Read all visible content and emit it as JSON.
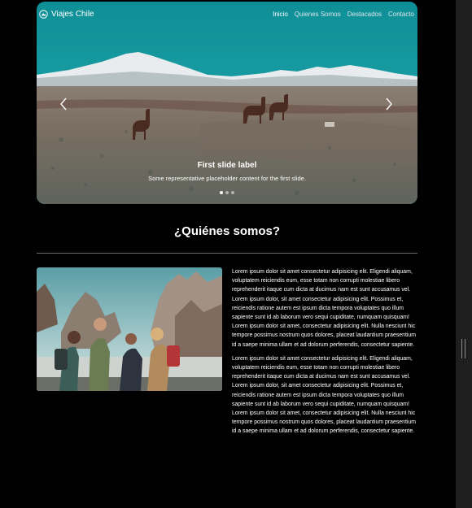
{
  "navbar": {
    "brand": "Viajes Chile",
    "links": [
      "Inicio",
      "Quienes Somos",
      "Destacados",
      "Contacto"
    ],
    "active_index": 0
  },
  "carousel": {
    "slide_title": "First slide label",
    "slide_text": "Some representative placeholder content for the first slide.",
    "slides_count": 3,
    "active_slide": 1
  },
  "about": {
    "title": "¿Quiénes somos?",
    "paragraphs": [
      "Lorem ipsum dolor sit amet consectetur adipisicing elit. Eligendi aliquam, voluptatem reiciendis eum, esse totam non corrupti molestiae libero reprehenderit itaque cum dicta at ducimus nam est sunt accusamus vel. Lorem ipsum dolor, sit amet consectetur adipisicing elit. Possimus et, reiciendis ratione autem est ipsum dicta tempora voluptates quo illum sapiente sunt id ab laborum vero sequi cupiditate, numquam quisquam! Lorem ipsum dolor sit amet, consectetur adipisicing elit. Nulla nesciunt hic tempore possimus nostrum quos dolores, placeat laudantium praesentium id a saepe minima ullam et ad dolorum perferendis, consectetur sapiente.",
      "Lorem ipsum dolor sit amet consectetur adipisicing elit. Eligendi aliquam, voluptatem reiciendis eum, esse totam non corrupti molestiae libero reprehenderit itaque cum dicta at ducimus nam est sunt accusamus vel. Lorem ipsum dolor, sit amet consectetur adipisicing elit. Possimus et, reiciendis ratione autem est ipsum dicta tempora voluptates quo illum sapiente sunt id ab laborum vero sequi cupiditate, numquam quisquam! Lorem ipsum dolor sit amet, consectetur adipisicing elit. Nulla nesciunt hic tempore possimus nostrum quos dolores, placeat laudantium praesentium id a saepe minima ullam et ad dolorum perferendis, consectetur sapiente."
    ]
  },
  "icons": {
    "brand": "logo-icon",
    "prev": "chevron-left-icon",
    "next": "chevron-right-icon"
  },
  "colors": {
    "page_background": "#000000",
    "sky": "#12999f",
    "text": "#ffffff",
    "divider": "#6b6b6b"
  }
}
